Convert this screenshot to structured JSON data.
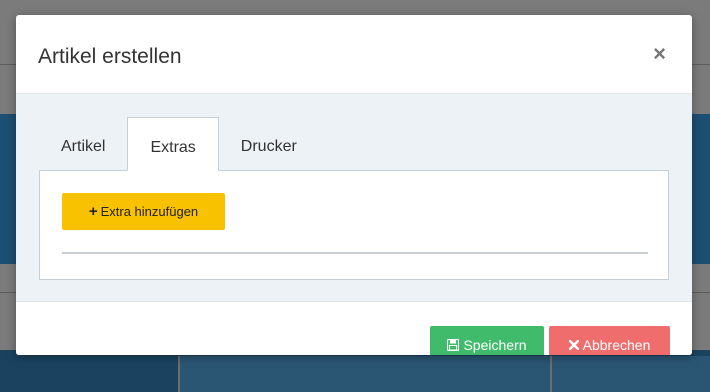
{
  "modal": {
    "title": "Artikel erstellen",
    "close_label": "×"
  },
  "tabs": [
    {
      "label": "Artikel",
      "active": false
    },
    {
      "label": "Extras",
      "active": true
    },
    {
      "label": "Drucker",
      "active": false
    }
  ],
  "extras_panel": {
    "add_button_label": "Extra hinzufügen",
    "add_button_icon": "plus-icon"
  },
  "footer": {
    "save_label": "Speichern",
    "save_icon": "floppy-disk-icon",
    "cancel_label": "Abbrechen",
    "cancel_icon": "x-icon"
  },
  "colors": {
    "add_button": "#f9c200",
    "save_button": "#3fbb6b",
    "cancel_button": "#ef6d6d",
    "body_bg": "#edf2f6",
    "backdrop": "#7b7b7b"
  }
}
